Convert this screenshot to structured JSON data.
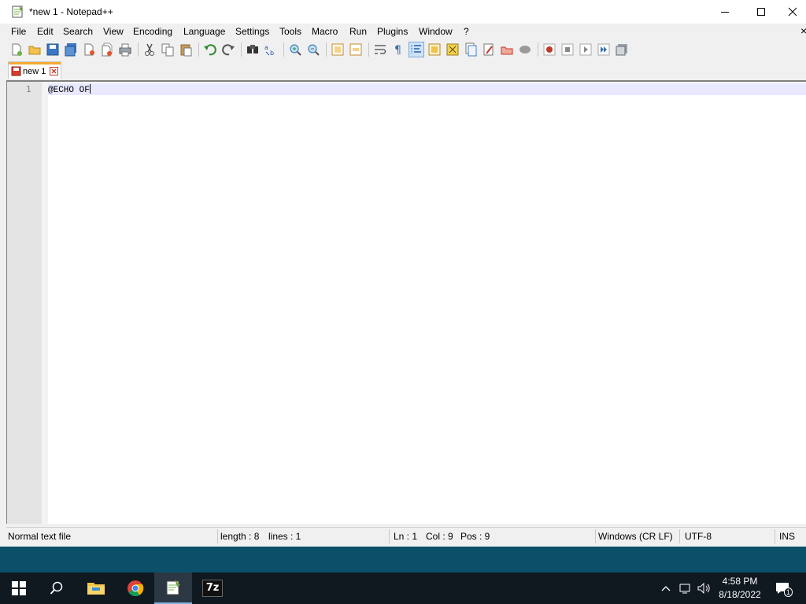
{
  "window": {
    "title": "*new 1 - Notepad++",
    "minimize_icon": "minimize-icon",
    "maximize_icon": "maximize-icon",
    "close_icon": "close-icon"
  },
  "menu": {
    "items": [
      "File",
      "Edit",
      "Search",
      "View",
      "Encoding",
      "Language",
      "Settings",
      "Tools",
      "Macro",
      "Run",
      "Plugins",
      "Window",
      "?"
    ],
    "close_glyph": "×"
  },
  "toolbar": {
    "icons": [
      "new-file-icon",
      "open-file-icon",
      "save-icon",
      "save-all-icon",
      "close-icon",
      "close-all-icon",
      "print-icon",
      "cut-icon",
      "copy-icon",
      "paste-icon",
      "undo-icon",
      "redo-icon",
      "find-icon",
      "replace-icon",
      "zoom-in-icon",
      "zoom-out-icon",
      "sync-vertical-icon",
      "sync-horizontal-icon",
      "word-wrap-icon",
      "show-all-characters-icon",
      "indent-guide-icon",
      "user-language-icon",
      "doc-map-icon",
      "function-list-icon",
      "folder-as-workspace-icon",
      "monitoring-icon",
      "record-macro-icon",
      "stop-record-icon",
      "playback-macro-icon",
      "run-macro-multiple-icon",
      "save-macro-icon"
    ]
  },
  "tabs": [
    {
      "label": "new 1",
      "icon": "unsaved-file-icon",
      "close_icon": "tab-close-icon",
      "active": true
    }
  ],
  "editor": {
    "lines": [
      {
        "number": "1",
        "text": "@ECHO OF"
      }
    ],
    "current_line_color": "#e8e8ff"
  },
  "status": {
    "file_type": "Normal text file",
    "length": "length : 8",
    "lines": "lines : 1",
    "ln": "Ln : 1",
    "col": "Col : 9",
    "pos": "Pos : 9",
    "eol": "Windows (CR LF)",
    "encoding": "UTF-8",
    "mode": "INS"
  },
  "taskbar": {
    "apps": [
      "start-icon",
      "search-icon",
      "file-explorer-icon",
      "chrome-icon",
      "notepadpp-icon",
      "7zip-icon"
    ],
    "seven_zip_label": "7z",
    "active_app": "notepadpp-icon",
    "tray_icons": [
      "show-hidden-icons-icon",
      "network-icon",
      "volume-icon",
      "notifications-icon"
    ],
    "notification_count": "1",
    "time": "4:58 PM",
    "date": "8/18/2022"
  },
  "colors": {
    "tab_accent": "#f7a833",
    "taskbar_bg": "#101820",
    "desktop_bg": "#0b5d7a"
  }
}
